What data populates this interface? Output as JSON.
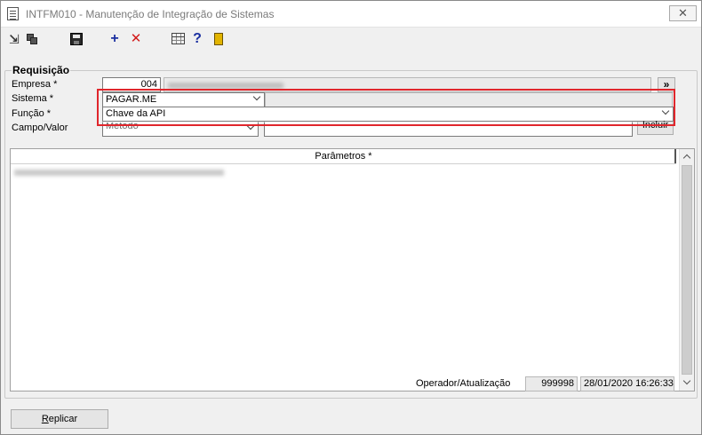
{
  "window": {
    "title": "INTFM010 - Manutenção de Integração de Sistemas",
    "close_symbol": "✕"
  },
  "toolbar": {
    "icons": [
      "arrow-icon",
      "copy-icon",
      "save-icon",
      "add-icon",
      "delete-icon",
      "calendar-grid-icon",
      "help-icon",
      "exit-door-icon"
    ],
    "plus": "+",
    "x": "✕",
    "help": "?"
  },
  "requisicao": {
    "legend": "Requisição",
    "empresa": {
      "label": "Empresa *",
      "code": "004",
      "more_button": "»"
    },
    "sistema": {
      "label": "Sistema *",
      "value": "PAGAR.ME"
    },
    "funcao": {
      "label": "Função *",
      "value": "Chave da API"
    },
    "campo_valor": {
      "label": "Campo/Valor",
      "campo": "Método",
      "valor": "",
      "incluir_button": "Incluir"
    }
  },
  "parametros": {
    "header": "Parâmetros *"
  },
  "footer": {
    "operador_label": "Operador/Atualização",
    "operador": "999998",
    "atualizacao": "28/01/2020 16:26:33"
  },
  "actions": {
    "replicar_first": "R",
    "replicar_rest": "eplicar"
  },
  "colors": {
    "highlight": "#e0262c",
    "add_icon": "#1a2fa0",
    "delete_icon": "#d21a1a",
    "window_bg": "#f0f0f0"
  }
}
